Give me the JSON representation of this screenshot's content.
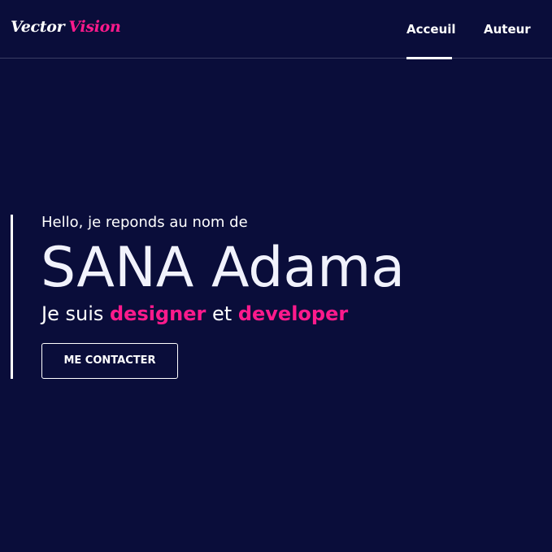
{
  "header": {
    "logo": {
      "word1": "Vector",
      "word2": "Vision"
    },
    "nav": {
      "items": [
        {
          "label": "Acceuil",
          "active": true
        },
        {
          "label": "Auteur",
          "active": false
        }
      ]
    }
  },
  "hero": {
    "greeting": "Hello, je reponds au nom de",
    "name": "SANA Adama",
    "role_prefix": "Je suis",
    "role_highlight1": "designer",
    "role_conjunction": "et",
    "role_highlight2": "developer",
    "cta_label": "ME CONTACTER"
  },
  "colors": {
    "background": "#0a0d3a",
    "accent": "#ff1a8c",
    "text": "#ffffff"
  }
}
